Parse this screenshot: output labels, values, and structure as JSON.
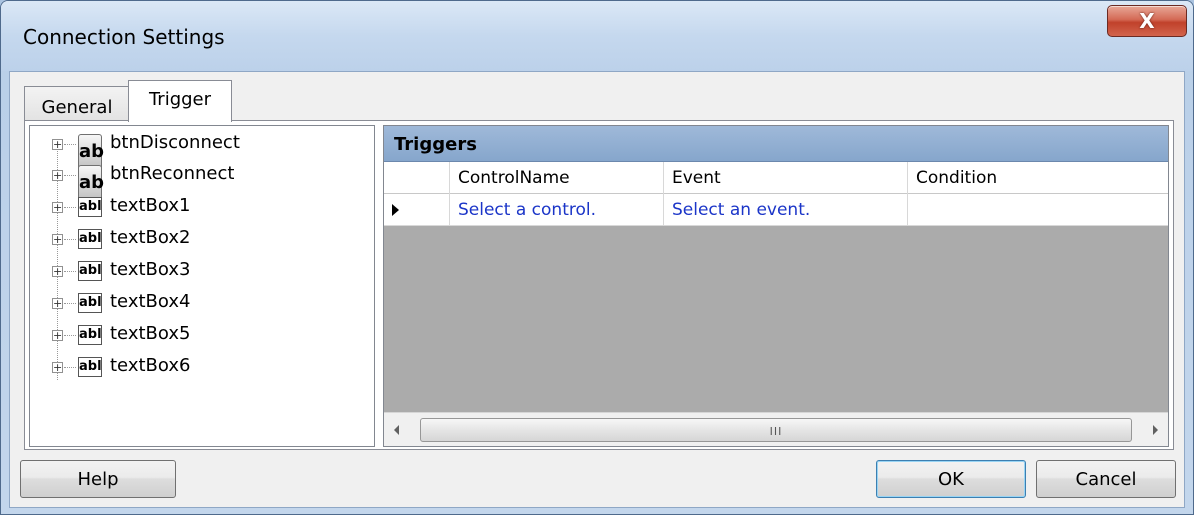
{
  "window": {
    "title": "Connection Settings",
    "close_label": "X"
  },
  "tabs": [
    {
      "label": "General",
      "selected": false
    },
    {
      "label": "Trigger",
      "selected": true
    }
  ],
  "tree": {
    "items": [
      {
        "label": "btnDisconnect",
        "icon": "ab"
      },
      {
        "label": "btnReconnect",
        "icon": "ab"
      },
      {
        "label": "textBox1",
        "icon": "abl"
      },
      {
        "label": "textBox2",
        "icon": "abl"
      },
      {
        "label": "textBox3",
        "icon": "abl"
      },
      {
        "label": "textBox4",
        "icon": "abl"
      },
      {
        "label": "textBox5",
        "icon": "abl"
      },
      {
        "label": "textBox6",
        "icon": "abl"
      }
    ]
  },
  "grid": {
    "caption": "Triggers",
    "columns": [
      "ControlName",
      "Event",
      "Condition"
    ],
    "rows": [
      {
        "ControlName": "Select a control.",
        "Event": "Select an event.",
        "Condition": ""
      }
    ],
    "scroll_grip": "III"
  },
  "buttons": {
    "help": "Help",
    "ok": "OK",
    "cancel": "Cancel"
  }
}
